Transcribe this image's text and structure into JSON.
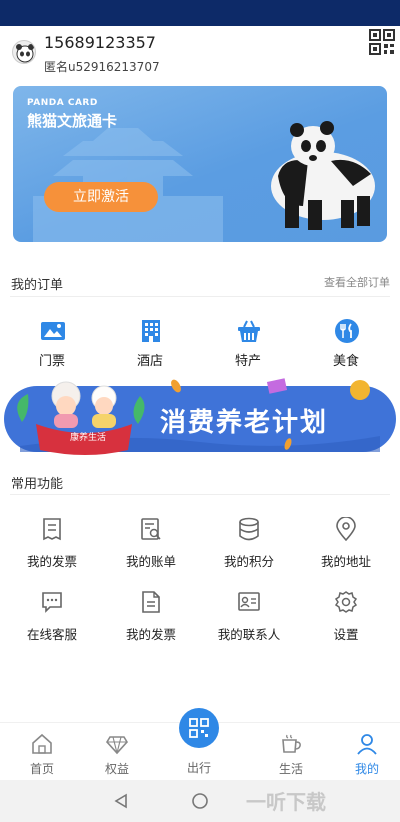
{
  "profile": {
    "phone": "15689123357",
    "anonymous_id": "匿名u52916213707"
  },
  "card": {
    "en_title": "PANDA CARD",
    "cn_title": "熊猫文旅通卡",
    "activate_label": "立即激活"
  },
  "orders": {
    "title": "我的订单",
    "more": "查看全部订单",
    "items": [
      {
        "label": "门票",
        "icon": "ticket-icon"
      },
      {
        "label": "酒店",
        "icon": "hotel-icon"
      },
      {
        "label": "特产",
        "icon": "basket-icon"
      },
      {
        "label": "美食",
        "icon": "food-icon"
      }
    ]
  },
  "banner": {
    "text": "消费养老计划",
    "sign": "康养生活"
  },
  "functions": {
    "title": "常用功能",
    "items": [
      {
        "label": "我的发票",
        "icon": "invoice-icon"
      },
      {
        "label": "我的账单",
        "icon": "bill-icon"
      },
      {
        "label": "我的积分",
        "icon": "points-icon"
      },
      {
        "label": "我的地址",
        "icon": "location-icon"
      },
      {
        "label": "在线客服",
        "icon": "chat-icon"
      },
      {
        "label": "我的发票",
        "icon": "document-icon"
      },
      {
        "label": "我的联系人",
        "icon": "contact-card-icon"
      },
      {
        "label": "设置",
        "icon": "gear-icon"
      }
    ]
  },
  "tabbar": {
    "items": [
      {
        "label": "首页",
        "icon": "home-icon"
      },
      {
        "label": "权益",
        "icon": "diamond-icon"
      },
      {
        "label": "出行",
        "icon": "qr-scan-icon"
      },
      {
        "label": "生活",
        "icon": "cup-icon"
      },
      {
        "label": "我的",
        "icon": "user-icon"
      }
    ],
    "active": "我的"
  },
  "watermark": "一听下载",
  "colors": {
    "status_bar": "#0d2a68",
    "accent": "#2f88e6",
    "card_button": "#f6913a"
  }
}
